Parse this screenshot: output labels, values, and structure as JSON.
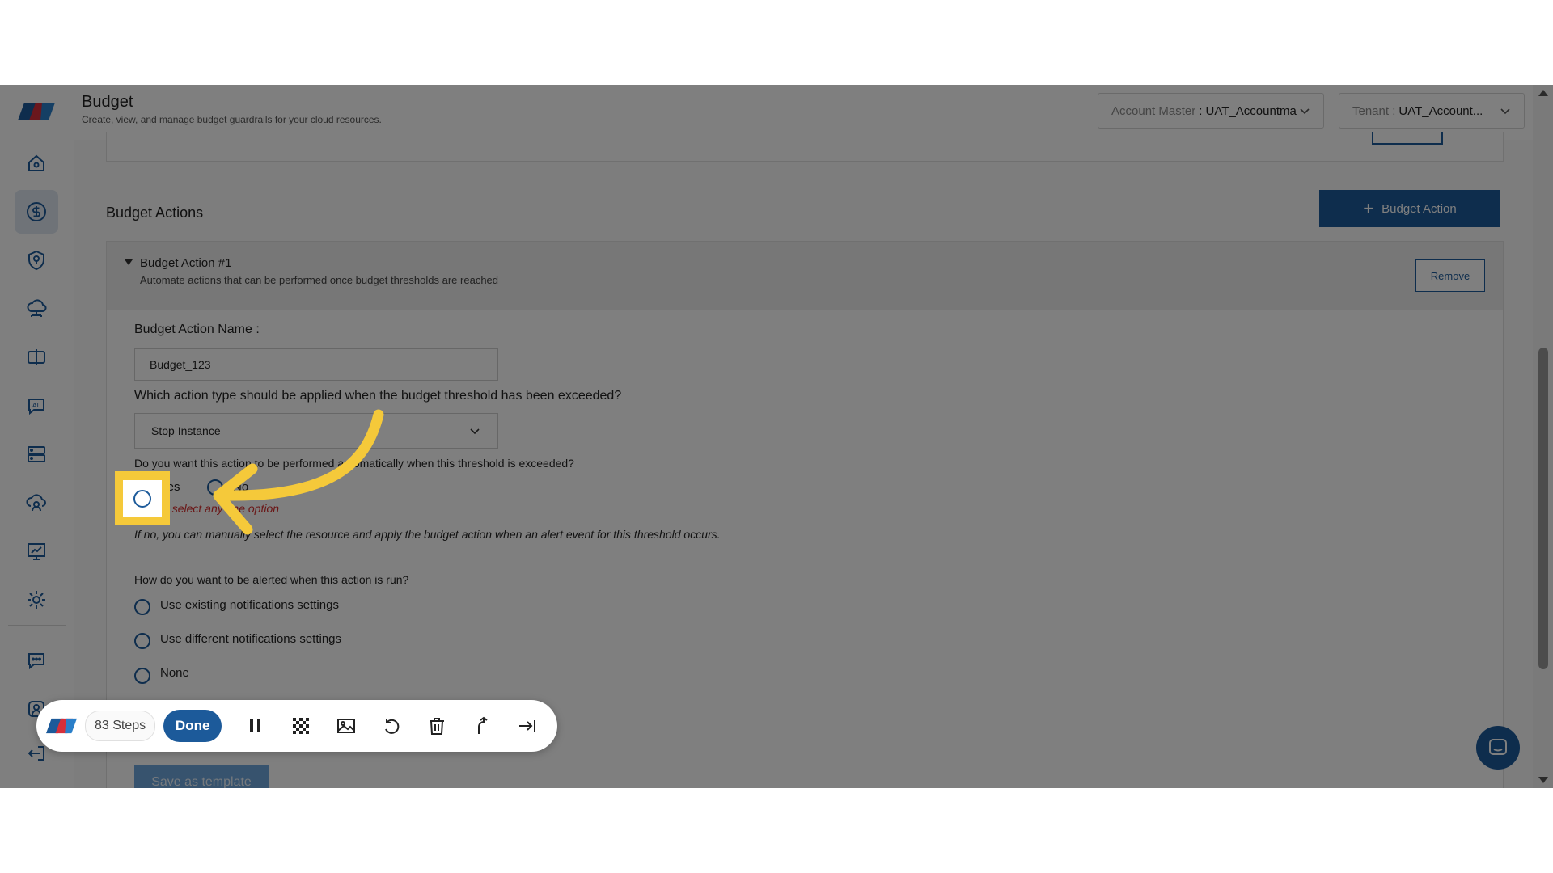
{
  "header": {
    "title": "Budget",
    "subtitle": "Create, view, and manage budget guardrails for your cloud resources.",
    "account_master_label": "Account Master",
    "account_master_value": ": UAT_Accountma",
    "tenant_label": "Tenant :",
    "tenant_value": "UAT_Account..."
  },
  "sidebar": {
    "icons": [
      "home-icon",
      "dollar-icon",
      "shield-icon",
      "cloud-network-icon",
      "split-icon",
      "ai-chat-icon",
      "server-icon",
      "cloud-user-icon",
      "monitor-chart-icon",
      "gear-icon",
      "chat-settings-icon",
      "user-support-icon",
      "logout-icon"
    ],
    "active": "dollar-icon"
  },
  "budget_actions": {
    "section_title": "Budget Actions",
    "add_button_label": "Budget Action",
    "action": {
      "title": "Budget Action #1",
      "description": "Automate actions that can be performed once budget thresholds are reached",
      "remove_label": "Remove",
      "name_label": "Budget Action Name :",
      "name_value": "Budget_123",
      "type_question": "Which action type should be applied when the budget threshold has been exceeded?",
      "type_value": "Stop Instance",
      "auto_question": "Do you want this action to be performed automatically when this threshold is exceeded?",
      "auto_options": [
        "Yes",
        "No"
      ],
      "auto_error": "Please select any one option",
      "auto_note": "If no, you can manually select the resource and apply the budget action when an alert event for this threshold occurs.",
      "alert_question": "How do you want to be alerted when this action is run?",
      "alert_options": [
        "Use existing notifications settings",
        "Use different notifications settings",
        "None"
      ]
    },
    "save_template_label": "Save as template"
  },
  "toolbar": {
    "steps_label": "83 Steps",
    "done_label": "Done",
    "icons": [
      "pause-icon",
      "blur-icon",
      "image-icon",
      "undo-icon",
      "trash-icon",
      "branch-icon",
      "skip-icon"
    ]
  },
  "colors": {
    "brand_blue": "#1c5a9a",
    "highlight_yellow": "#f5c93a",
    "error_red": "#d42b2b"
  }
}
